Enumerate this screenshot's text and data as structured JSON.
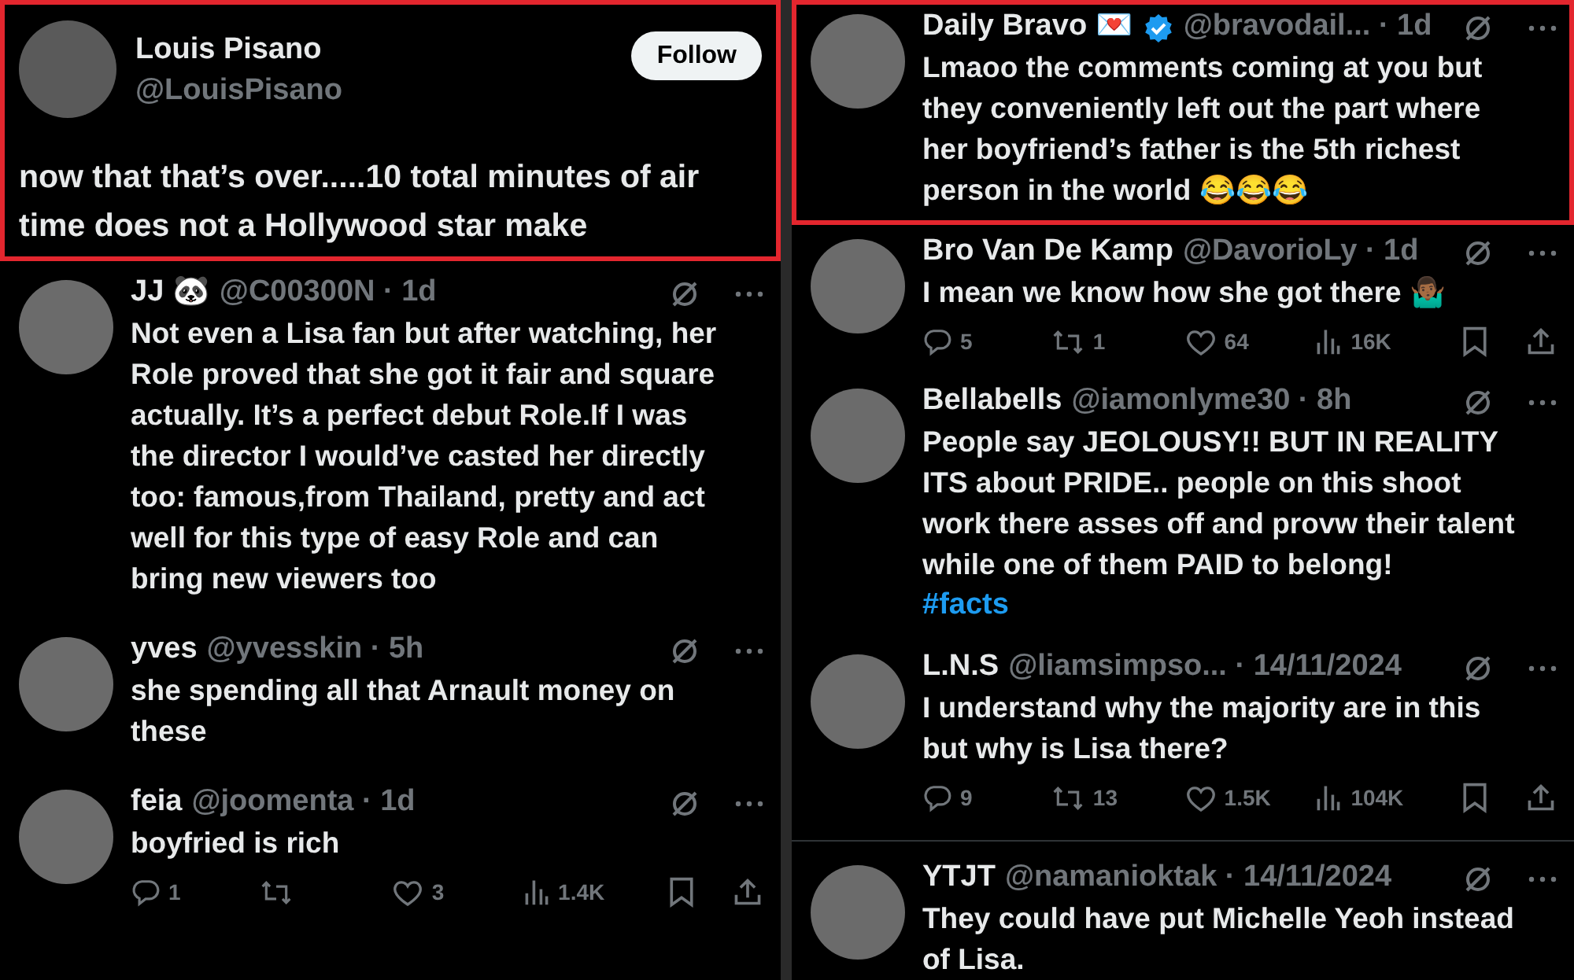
{
  "left_column": {
    "main_post": {
      "highlighted": true,
      "name": "Louis Pisano",
      "handle": "@LouisPisano",
      "follow_button": "Follow",
      "text": "now that that’s over.....10 total minutes of air time does not a Hollywood star make"
    },
    "replies": [
      {
        "highlighted": false,
        "name": "JJ 🐼",
        "meta": "@C00300N · 1d",
        "text": "Not even a Lisa fan but after watching, her Role proved that she got it fair and square actually. It’s a perfect debut Role.If I was the director I would’ve casted her directly too: famous,from Thailand, pretty and act well for this type of easy Role and can bring new viewers too"
      },
      {
        "highlighted": false,
        "name": "yves",
        "meta": "@yvesskin · 5h",
        "text": "she spending all that Arnault money on these"
      },
      {
        "highlighted": false,
        "name": "feia",
        "meta": "@joomenta · 1d",
        "text": "boyfried is rich",
        "actions": [
          {
            "kind": "reply",
            "count": "1"
          },
          {
            "kind": "repost"
          },
          {
            "kind": "like",
            "count": "3"
          },
          {
            "kind": "views",
            "count": "1.4K"
          },
          {
            "kind": "bookmark"
          },
          {
            "kind": "share"
          }
        ]
      }
    ]
  },
  "right_column": {
    "replies": [
      {
        "highlighted": true,
        "name": "Daily Bravo 💌",
        "verified": true,
        "meta": "@bravodail... · 1d",
        "text": "Lmaoo the comments coming at you but they conveniently left out the part where her boyfriend’s father is the 5th richest person in the world 😂😂😂"
      },
      {
        "highlighted": false,
        "name": "Bro Van De Kamp",
        "meta": "@DavorioLy · 1d",
        "text": "I mean we know how she got there 🤷🏾‍♂️",
        "actions": [
          {
            "kind": "reply",
            "count": "5"
          },
          {
            "kind": "repost",
            "count": "1"
          },
          {
            "kind": "like",
            "count": "64"
          },
          {
            "kind": "views",
            "count": "16K"
          },
          {
            "kind": "bookmark"
          },
          {
            "kind": "share"
          }
        ]
      },
      {
        "highlighted": false,
        "name": "Bellabells",
        "meta": "@iamonlyme30 · 8h",
        "text": "People say JEOLOUSY!! BUT IN REALITY ITS about PRIDE.. people on this shoot work there asses off and provw their talent while one of them PAID to belong!",
        "hashtag": "#facts"
      },
      {
        "highlighted": false,
        "name": "L.N.S",
        "meta": "@liamsimpso... · 14/11/2024",
        "text": "I understand why the majority are in this but why is Lisa there?",
        "actions": [
          {
            "kind": "reply",
            "count": "9"
          },
          {
            "kind": "repost",
            "count": "13"
          },
          {
            "kind": "like",
            "count": "1.5K"
          },
          {
            "kind": "views",
            "count": "104K"
          },
          {
            "kind": "bookmark"
          },
          {
            "kind": "share"
          }
        ],
        "divider_below": true
      },
      {
        "highlighted": false,
        "name": "YTJT",
        "meta": "@namanioktak · 14/11/2024",
        "text": "They could have put Michelle Yeoh instead of Lisa."
      }
    ]
  }
}
